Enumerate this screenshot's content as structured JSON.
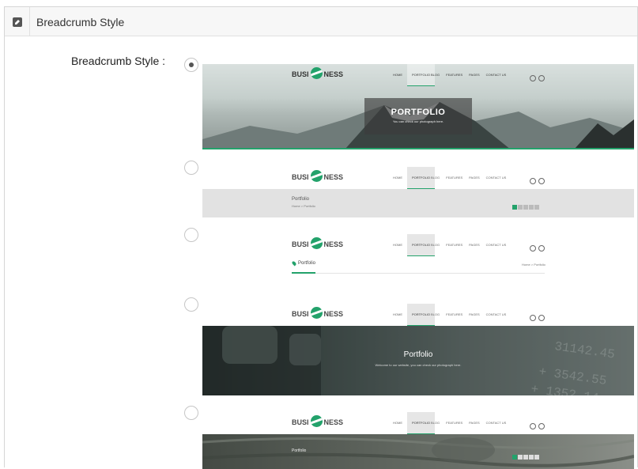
{
  "header": {
    "title": "Breadcrumb Style",
    "icon": "edit-icon"
  },
  "field": {
    "label": "Breadcrumb Style :"
  },
  "nav": {
    "logo_left": "BUSI",
    "logo_right": "NESS",
    "items": [
      "HOME",
      "PORTFOLIO",
      "BLOG",
      "FEATURES",
      "PAGES",
      "CONTACT US"
    ],
    "active": "PORTFOLIO"
  },
  "options": [
    {
      "selected": true,
      "title": "PORTFOLIO",
      "subtitle": "You can check our photograph here."
    },
    {
      "selected": false,
      "title": "Portfolio",
      "crumb": "Home  >  Portfolio"
    },
    {
      "selected": false,
      "title": "Portfolio",
      "crumb": "Home  >  Portfolio"
    },
    {
      "selected": false,
      "title": "Portfolio",
      "subtitle": "Welcome to our website, you can check our photograph here."
    },
    {
      "selected": false,
      "title": "Portfolio"
    }
  ],
  "colors": {
    "accent": "#23a26b",
    "panel_header": "#f7f7f7"
  }
}
